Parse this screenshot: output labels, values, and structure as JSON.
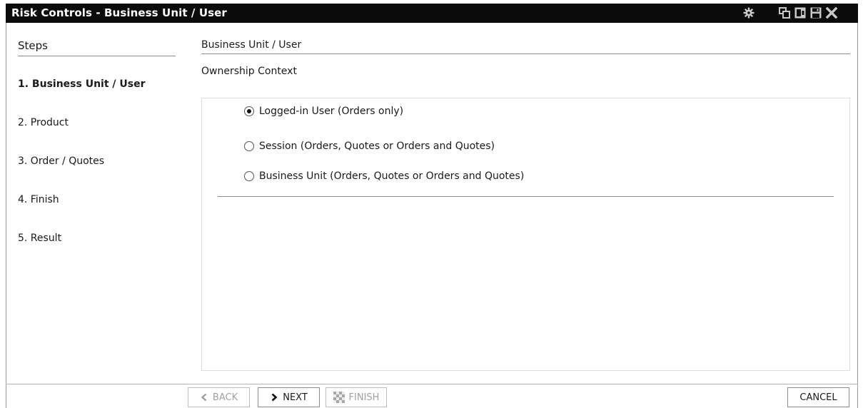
{
  "window": {
    "title": "Risk Controls - Business Unit / User",
    "controls": {
      "settings": "gear-icon",
      "restore": "restore-window-icon",
      "dock": "dock-icon",
      "save": "save-icon",
      "close": "close-icon"
    }
  },
  "sidebar": {
    "title": "Steps",
    "steps": [
      {
        "label": "1. Business Unit / User",
        "active": true
      },
      {
        "label": "2. Product",
        "active": false
      },
      {
        "label": "3. Order / Quotes",
        "active": false
      },
      {
        "label": "4. Finish",
        "active": false
      },
      {
        "label": "5. Result",
        "active": false
      }
    ]
  },
  "main": {
    "title": "Business Unit / User",
    "section_label": "Ownership Context",
    "options": [
      {
        "label": "Logged-in User (Orders only)",
        "selected": true
      },
      {
        "label": "Session (Orders, Quotes or Orders and Quotes)",
        "selected": false
      },
      {
        "label": "Business Unit (Orders, Quotes or Orders and Quotes)",
        "selected": false
      }
    ]
  },
  "footer": {
    "back": {
      "label": "BACK",
      "enabled": false,
      "icon": "chevron-left-icon"
    },
    "next": {
      "label": "NEXT",
      "enabled": true,
      "icon": "chevron-right-icon"
    },
    "finish": {
      "label": "FINISH",
      "enabled": false,
      "icon": "checkered-flag-icon"
    },
    "cancel": {
      "label": "CANCEL",
      "enabled": true
    }
  },
  "colors": {
    "titlebar_bg": "#0b0b0b",
    "titlebar_text": "#ffffff",
    "disabled_text": "#a0a0a0"
  }
}
